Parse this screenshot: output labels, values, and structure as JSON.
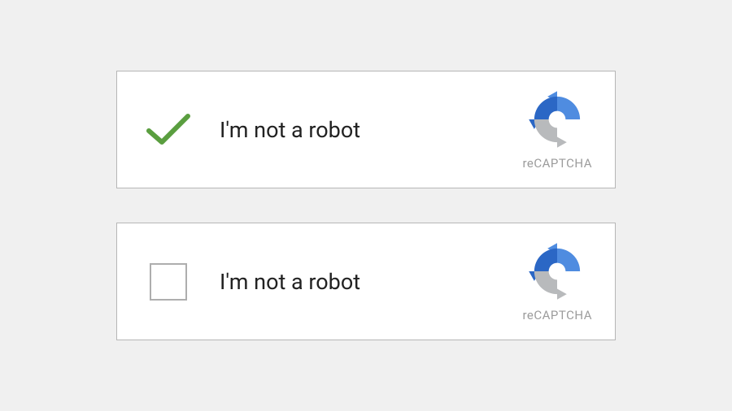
{
  "widgets": [
    {
      "label": "I'm not a robot",
      "brand": "reCAPTCHA",
      "checked": true
    },
    {
      "label": "I'm not a robot",
      "brand": "reCAPTCHA",
      "checked": false
    }
  ],
  "colors": {
    "checkmark": "#5a9e3f",
    "logo_dark_blue": "#2b67c5",
    "logo_light_blue": "#4f8ce0",
    "logo_gray": "#b8babc"
  }
}
